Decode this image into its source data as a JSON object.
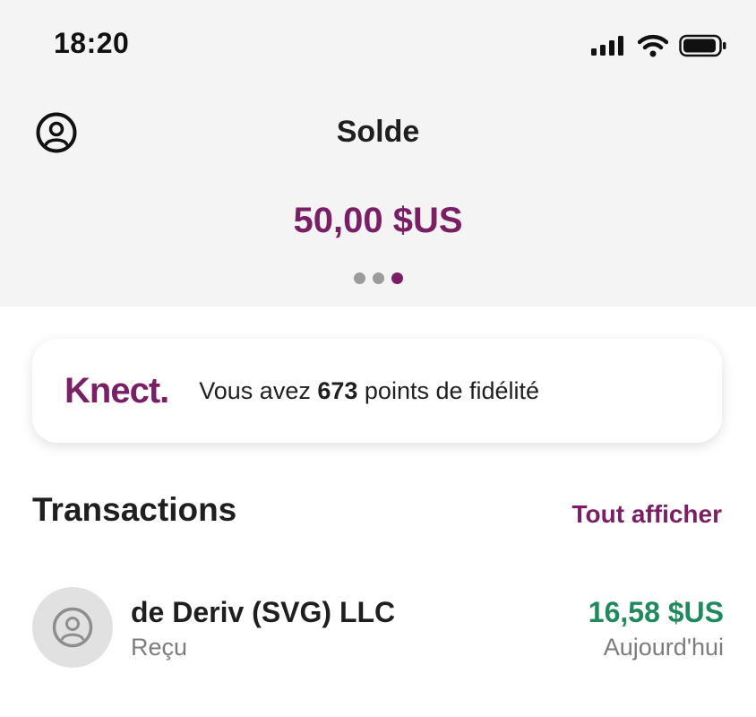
{
  "status_bar": {
    "time": "18:20"
  },
  "header": {
    "title": "Solde",
    "balance": "50,00 $US"
  },
  "carousel": {
    "pages": 3,
    "active_index": 2
  },
  "loyalty_card": {
    "brand": "Knect.",
    "prefix": "Vous avez ",
    "points": "673",
    "suffix": " points de fidélité"
  },
  "transactions": {
    "heading": "Transactions",
    "see_all": "Tout afficher",
    "items": [
      {
        "name": "de Deriv (SVG) LLC",
        "type": "Reçu",
        "amount": "16,58 $US",
        "date": "Aujourd'hui"
      }
    ]
  },
  "colors": {
    "accent": "#7a1f66",
    "positive": "#1f8a5c",
    "muted": "#7c7c7c",
    "header_bg": "#f4f4f4"
  }
}
